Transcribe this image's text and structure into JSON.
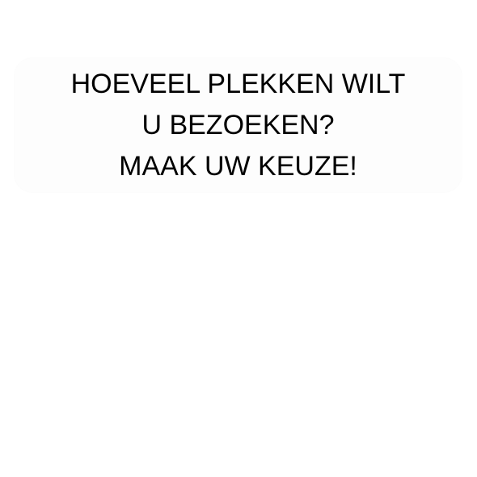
{
  "prompt": {
    "lines": [
      "HOEVEEL PLEKKEN WILT",
      "U BEZOEKEN?",
      "MAAK UW KEUZE!"
    ]
  }
}
